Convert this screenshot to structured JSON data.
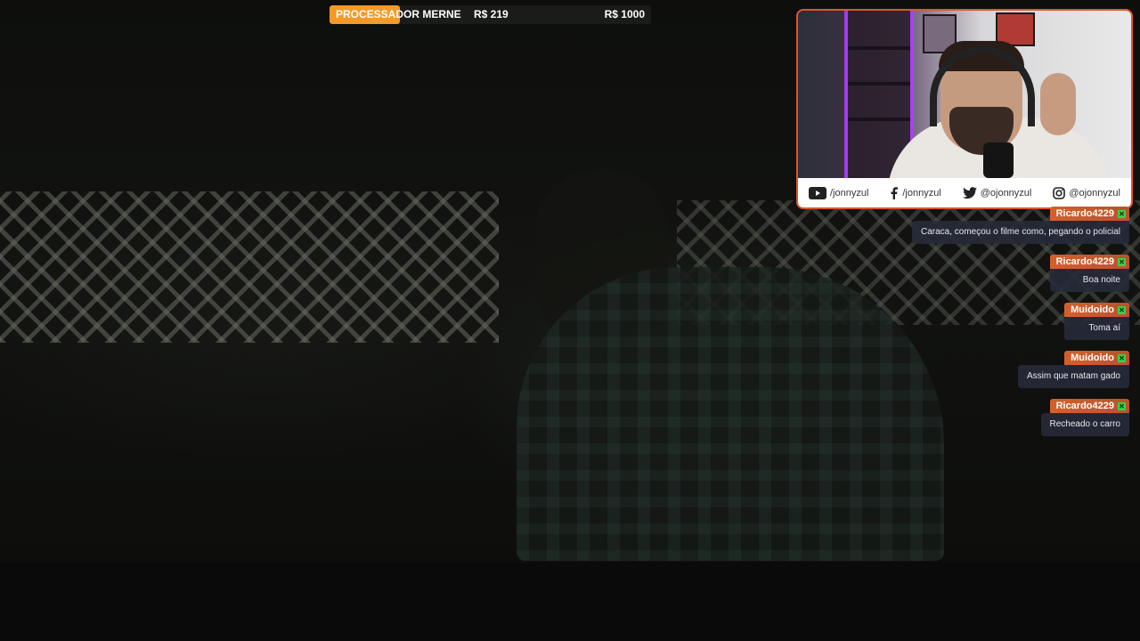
{
  "goal": {
    "label": "PROCESSADOR MERNE",
    "current": "R$ 219",
    "target": "R$ 1000",
    "progress": 0.219,
    "fill_color": "#f39a27"
  },
  "socials": [
    {
      "icon": "youtube-icon",
      "handle": "/jonnyzul"
    },
    {
      "icon": "facebook-icon",
      "handle": "/jonnyzul"
    },
    {
      "icon": "twitter-icon",
      "handle": "@ojonnyzul"
    },
    {
      "icon": "instagram-icon",
      "handle": "@ojonnyzul"
    }
  ],
  "chat": [
    {
      "user": "Ricardo4229",
      "text": "Caraca, começou o filme como, pegando o policial"
    },
    {
      "user": "Ricardo4229",
      "text": "Boa noite"
    },
    {
      "user": "Muidoido",
      "text": "Toma aí"
    },
    {
      "user": "Muidoido",
      "text": "Assim que matam gado"
    },
    {
      "user": "Ricardo4229",
      "text": "Recheado o carro"
    }
  ],
  "colors": {
    "cam_border": "#e4532c",
    "name_tag": "#d4602b",
    "badge": "#3ad14a"
  }
}
